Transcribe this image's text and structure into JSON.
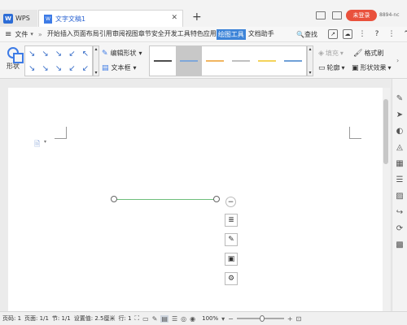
{
  "titlebar": {
    "app_label": "WPS",
    "app_logo": "W",
    "doc_tab_label": "文字文稿1",
    "doc_icon": "W",
    "new_tab": "+",
    "login_label": "未登录",
    "account_text": "8894-nc"
  },
  "menubar": {
    "file_label": "文件",
    "items": [
      "开始",
      "插入",
      "页面布局",
      "引用",
      "审阅",
      "视图",
      "章节",
      "安全",
      "开发工具",
      "特色应用"
    ],
    "active_item": "绘图工具",
    "extra_item": "文档助手",
    "search_label": "查找",
    "help": "?"
  },
  "ribbon": {
    "shape_label": "形状",
    "gallery_arrows": [
      "↘",
      "↘",
      "↘",
      "↙",
      "↖",
      "↘",
      "↘",
      "↘",
      "↙",
      "↙"
    ],
    "edit_shape_label": "编辑形状",
    "textbox_label": "文本框",
    "line_styles": [
      "#4d4d4d",
      "#7fa7d9",
      "#f1b560",
      "#c0c0c0",
      "#f4d35a",
      "#6fa0d7"
    ],
    "fill_label": "填充",
    "outline_label": "轮廓",
    "format_brush_label": "格式刷",
    "shape_effects_label": "形状效果"
  },
  "statusbar": {
    "page_num": "页码: 1",
    "pages": "页面: 1/1",
    "section": "节: 1/1",
    "setting": "设置值: 2.5厘米",
    "row": "行: 1",
    "zoom": "100%"
  }
}
